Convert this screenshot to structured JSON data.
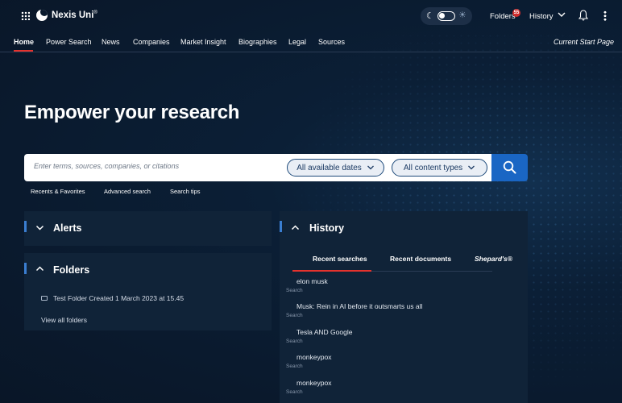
{
  "app": {
    "name": "Nexis Uni",
    "trademark": "®"
  },
  "topbar": {
    "folders_label": "Folders",
    "folders_badge": "55",
    "history_label": "History",
    "icons": [
      "grid-menu-icon",
      "moon-icon",
      "sun-icon",
      "bell-icon",
      "kebab-menu-icon",
      "chevron-down-icon"
    ]
  },
  "nav": {
    "items": [
      "Home",
      "Power Search",
      "News",
      "Companies",
      "Market Insight",
      "Biographies",
      "Legal",
      "Sources"
    ],
    "active": "Home",
    "current_start_page": "Current Start Page"
  },
  "hero": {
    "title": "Empower your research"
  },
  "search": {
    "placeholder": "Enter terms, sources, companies, or citations",
    "date_filter": "All available dates",
    "content_filter": "All content types",
    "links": [
      "Recents & Favorites",
      "Advanced search",
      "Search tips"
    ]
  },
  "alerts": {
    "title": "Alerts"
  },
  "folders": {
    "title": "Folders",
    "items": [
      "Test Folder Created 1 March 2023 at 15.45"
    ],
    "view_all": "View all folders"
  },
  "history": {
    "title": "History",
    "tabs": [
      "Recent searches",
      "Recent documents",
      "Shepard's®"
    ],
    "active_tab": "Recent searches",
    "items": [
      {
        "query": "elon musk",
        "kind": "Search"
      },
      {
        "query": "Musk: Rein in AI before it outsmarts us all",
        "kind": "Search"
      },
      {
        "query": "Tesla AND Google",
        "kind": "Search"
      },
      {
        "query": "monkeypox",
        "kind": "Search"
      },
      {
        "query": "monkeypox",
        "kind": "Search"
      }
    ]
  },
  "colors": {
    "background": "#0a1a2e",
    "panel": "#102338",
    "accent": "#1a66c4",
    "active_red": "#e5322d"
  }
}
